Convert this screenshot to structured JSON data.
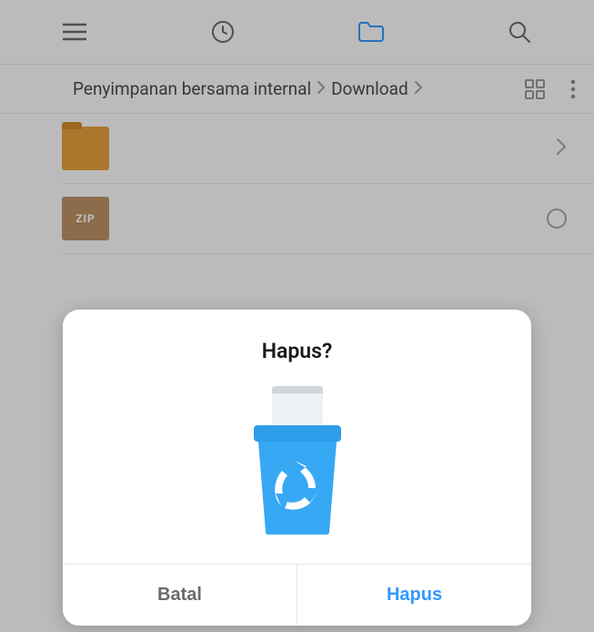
{
  "breadcrumb": {
    "segments": [
      "Penyimpanan bersama internal",
      "Download"
    ]
  },
  "files": {
    "zip_label": "ZIP"
  },
  "dialog": {
    "title": "Hapus?",
    "cancel_label": "Batal",
    "confirm_label": "Hapus"
  }
}
